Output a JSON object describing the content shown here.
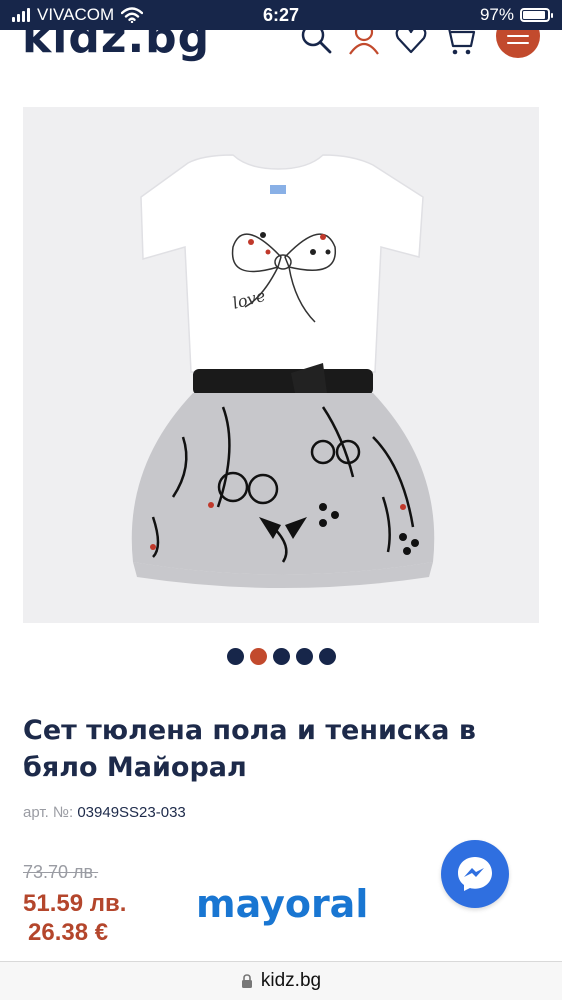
{
  "status_bar": {
    "carrier": "VIVACOM",
    "time": "6:27",
    "battery": "97%"
  },
  "header": {
    "logo": "kidz.bg"
  },
  "icons": {
    "search": "search-icon",
    "account": "user-icon",
    "wishlist": "heart-icon",
    "cart": "cart-icon",
    "menu": "hamburger-menu-icon",
    "chat": "messenger-icon",
    "lock": "lock-icon"
  },
  "carousel": {
    "total": 5,
    "active": 2
  },
  "product": {
    "title": "Сет тюлена пола и тениска в бяло Майорал",
    "sku_label": "арт. №:",
    "sku": "03949SS23-033",
    "old_price": "73.70 лв.",
    "price_bgn": "51.59 лв.",
    "price_eur": "26.38 €",
    "brand": "mayoral"
  },
  "browser": {
    "url": "kidz.bg"
  },
  "colors": {
    "navy": "#17264a",
    "accent": "#c24a2d",
    "price": "#b4462c",
    "brand": "#1976d2",
    "messenger": "#2f6fe0"
  }
}
